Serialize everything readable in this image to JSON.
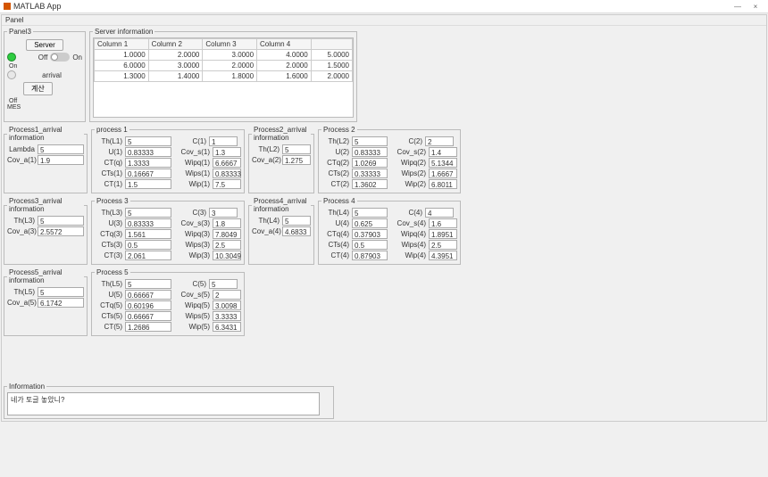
{
  "window": {
    "title": "MATLAB App",
    "minimize": "—",
    "close": "×"
  },
  "outer_panel": "Panel",
  "panel3": {
    "title": "Panel3",
    "server_btn": "Server",
    "on_label": "On",
    "off_label": "Off",
    "toggle_on": "On",
    "toggle_off": "Off",
    "arrival_label": "arrival",
    "mes_label": "MES",
    "calc_btn": "계산"
  },
  "server_info": {
    "title": "Server information",
    "columns": [
      "Column 1",
      "Column 2",
      "Column 3",
      "Column 4"
    ],
    "rows": [
      [
        "1.0000",
        "2.0000",
        "3.0000",
        "4.0000",
        "5.0000"
      ],
      [
        "6.0000",
        "3.0000",
        "2.0000",
        "2.0000",
        "1.5000"
      ],
      [
        "1.3000",
        "1.4000",
        "1.8000",
        "1.6000",
        "2.0000"
      ]
    ]
  },
  "p1_arr": {
    "title": "Process1_arrival information",
    "lambda_lbl": "Lambda",
    "lambda": "5",
    "cova_lbl": "Cov_a(1)",
    "cova": "1.9"
  },
  "p1": {
    "title": "process 1",
    "th_lbl": "Th(L1)",
    "th": "5",
    "c_lbl": "C(1)",
    "c": "1",
    "u_lbl": "U(1)",
    "u": "0.83333",
    "covs_lbl": "Cov_s(1)",
    "covs": "1.3",
    "ctq_lbl": "CT(q)",
    "ctq": "1.3333",
    "wipq_lbl": "Wipq(1)",
    "wipq": "6.6667",
    "cts_lbl": "CTs(1)",
    "cts": "0.16667",
    "wips_lbl": "Wips(1)",
    "wips": "0.83333",
    "ct_lbl": "CT(1)",
    "ct": "1.5",
    "wip_lbl": "Wip(1)",
    "wip": "7.5"
  },
  "p2_arr": {
    "title": "Process2_arrival information",
    "th_lbl": "Th(L2)",
    "th": "5",
    "cova_lbl": "Cov_a(2)",
    "cova": "1.275"
  },
  "p2": {
    "title": "Process 2",
    "th_lbl": "Th(L2)",
    "th": "5",
    "c_lbl": "C(2)",
    "c": "2",
    "u_lbl": "U(2)",
    "u": "0.83333",
    "covs_lbl": "Cov_s(2)",
    "covs": "1.4",
    "ctq_lbl": "CTq(2)",
    "ctq": "1.0269",
    "wipq_lbl": "Wipq(2)",
    "wipq": "5.1344",
    "cts_lbl": "CTs(2)",
    "cts": "0.33333",
    "wips_lbl": "Wips(2)",
    "wips": "1.6667",
    "ct_lbl": "CT(2)",
    "ct": "1.3602",
    "wip_lbl": "Wip(2)",
    "wip": "6.8011"
  },
  "p3_arr": {
    "title": "Process3_arrival information",
    "th_lbl": "Th(L3)",
    "th": "5",
    "cova_lbl": "Cov_a(3)",
    "cova": "2.5572"
  },
  "p3": {
    "title": "Process 3",
    "th_lbl": "Th(L3)",
    "th": "5",
    "c_lbl": "C(3)",
    "c": "3",
    "u_lbl": "U(3)",
    "u": "0.83333",
    "covs_lbl": "Cov_s(3)",
    "covs": "1.8",
    "ctq_lbl": "CTq(3)",
    "ctq": "1.561",
    "wipq_lbl": "Wipq(3)",
    "wipq": "7.8049",
    "cts_lbl": "CTs(3)",
    "cts": "0.5",
    "wips_lbl": "Wips(3)",
    "wips": "2.5",
    "ct_lbl": "CT(3)",
    "ct": "2.061",
    "wip_lbl": "Wip(3)",
    "wip": "10.3049"
  },
  "p4_arr": {
    "title": "Process4_arrival information",
    "th_lbl": "Th(L4)",
    "th": "5",
    "cova_lbl": "Cov_a(4)",
    "cova": "4.6833"
  },
  "p4": {
    "title": "Process 4",
    "th_lbl": "Th(L4)",
    "th": "5",
    "c_lbl": "C(4)",
    "c": "4",
    "u_lbl": "U(4)",
    "u": "0.625",
    "covs_lbl": "Cov_s(4)",
    "covs": "1.6",
    "ctq_lbl": "CTq(4)",
    "ctq": "0.37903",
    "wipq_lbl": "Wipq(4)",
    "wipq": "1.8951",
    "cts_lbl": "CTs(4)",
    "cts": "0.5",
    "wips_lbl": "Wips(4)",
    "wips": "2.5",
    "ct_lbl": "CT(4)",
    "ct": "0.87903",
    "wip_lbl": "Wip(4)",
    "wip": "4.3951"
  },
  "p5_arr": {
    "title": "Process5_arrival information",
    "th_lbl": "Th(L5)",
    "th": "5",
    "cova_lbl": "Cov_a(5)",
    "cova": "6.1742"
  },
  "p5": {
    "title": "Process 5",
    "th_lbl": "Th(L5)",
    "th": "5",
    "c_lbl": "C(5)",
    "c": "5",
    "u_lbl": "U(5)",
    "u": "0.66667",
    "covs_lbl": "Cov_s(5)",
    "covs": "2",
    "ctq_lbl": "CTq(5)",
    "ctq": "0.60196",
    "wipq_lbl": "Wipq(5)",
    "wipq": "3.0098",
    "cts_lbl": "CTs(5)",
    "cts": "0.66667",
    "wips_lbl": "Wips(5)",
    "wips": "3.3333",
    "ct_lbl": "CT(5)",
    "ct": "1.2686",
    "wip_lbl": "Wip(5)",
    "wip": "6.3431"
  },
  "info": {
    "title": "Information",
    "text": "네가 토글 놓았니?"
  }
}
